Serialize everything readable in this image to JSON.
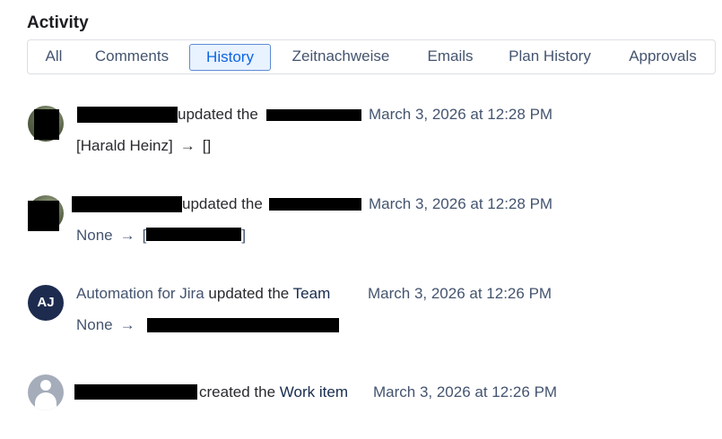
{
  "activity": {
    "title": "Activity",
    "tabs": [
      {
        "label": "All"
      },
      {
        "label": "Comments"
      },
      {
        "label": "History",
        "active": true
      },
      {
        "label": "Zeitnachweise"
      },
      {
        "label": "Emails"
      },
      {
        "label": "Plan History"
      },
      {
        "label": "Approvals"
      }
    ]
  },
  "history": [
    {
      "action": "updated the",
      "timestamp": "March 3, 2026 at 12:28 PM",
      "change": {
        "from": "[Harald Heinz]",
        "arrow": "→",
        "to": "[]"
      }
    },
    {
      "action": "updated the",
      "timestamp": "March 3, 2026 at 12:28 PM",
      "change": {
        "from": "None",
        "arrow": "→",
        "to_prefix": "[",
        "to_suffix": "]"
      }
    },
    {
      "avatar_initials": "AJ",
      "actor": "Automation for Jira",
      "action": "updated the",
      "field": "Team",
      "timestamp": "March 3, 2026 at 12:26 PM",
      "change": {
        "from": "None",
        "arrow": "→"
      }
    },
    {
      "action": "created the",
      "field": "Work item",
      "timestamp": "March 3, 2026 at 12:26 PM"
    }
  ],
  "colors": {
    "accent": "#0C66E4",
    "avatar_aj": "#1D2B4F"
  }
}
